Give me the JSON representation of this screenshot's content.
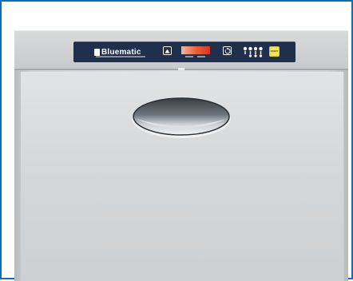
{
  "appliance": {
    "brand": "Bluematic",
    "start_label": "START",
    "icons": {
      "up_button": "up-arrow-icon",
      "cycle_button": "cycle-icon",
      "program_dots": "program-dots-icon",
      "handle": "door-handle-icon"
    },
    "colors": {
      "frame_border": "#0d6fb6",
      "panel": "#1f2f4c",
      "display": "#ef5a32",
      "start_button": "#f4e45a",
      "steel": "#d6d8da"
    }
  }
}
